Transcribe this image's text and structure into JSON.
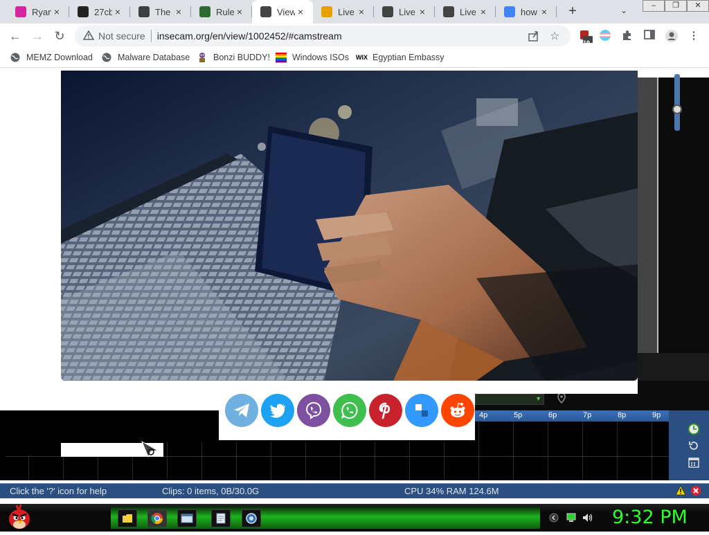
{
  "tabs": [
    {
      "title": "Ryan",
      "icon": "instagram-icon",
      "color": "#d6249f",
      "active": false
    },
    {
      "title": "27cb",
      "icon": "b-site-icon",
      "color": "#222222",
      "active": false
    },
    {
      "title": "The",
      "icon": "factory-icon",
      "color": "#3c4043",
      "active": false
    },
    {
      "title": "Rule",
      "icon": "rule-site-icon",
      "color": "#2e6b2e",
      "active": false
    },
    {
      "title": "View",
      "icon": "camera-icon",
      "color": "#444444",
      "active": true
    },
    {
      "title": "Live",
      "icon": "triangle-icon",
      "color": "#e8a000",
      "active": false
    },
    {
      "title": "Live",
      "icon": "camera-icon",
      "color": "#444444",
      "active": false
    },
    {
      "title": "Live",
      "icon": "camera-icon",
      "color": "#444444",
      "active": false
    },
    {
      "title": "how",
      "icon": "google-icon",
      "color": "#4285f4",
      "active": false
    }
  ],
  "tab_close_glyph": "×",
  "newtab_glyph": "+",
  "tabmenu_glyph": "⌄",
  "window_buttons": {
    "minimize": "–",
    "restore": "❐",
    "close": "✕"
  },
  "toolbar": {
    "back": "←",
    "forward": "→",
    "reload": "↻",
    "security_label": "Not secure",
    "url": "insecam.org/en/view/1002452/#camstream",
    "extension_badge": "19"
  },
  "bookmarks": [
    {
      "label": "MEMZ Download",
      "icon": "globe-icon"
    },
    {
      "label": "Malware Database",
      "icon": "globe-icon"
    },
    {
      "label": "Bonzi BUDDY!",
      "icon": "bonzi-icon"
    },
    {
      "label": "Windows ISOs",
      "icon": "windows-icon"
    },
    {
      "label": "Egyptian Embassy",
      "icon": "wix-icon"
    }
  ],
  "wix_text": "WIX",
  "share_buttons": [
    {
      "name": "telegram",
      "color": "#6fb0e0"
    },
    {
      "name": "twitter",
      "color": "#1da1f2"
    },
    {
      "name": "viber",
      "color": "#7d51a0"
    },
    {
      "name": "whatsapp",
      "color": "#3fbf4f"
    },
    {
      "name": "pinterest",
      "color": "#c8232c"
    },
    {
      "name": "delicious",
      "color": "#3399ff"
    },
    {
      "name": "reddit",
      "color": "#ff4500"
    }
  ],
  "timeline_hours": [
    "4p",
    "5p",
    "6p",
    "7p",
    "8p",
    "9p"
  ],
  "statusbar": {
    "help": "Click the '?' icon for help",
    "clips": "Clips: 0 items, 0B/30.0G",
    "system": "CPU 34% RAM 124.6M"
  },
  "taskbar": {
    "clock": "9:32 PM",
    "apps": [
      "folder-icon",
      "chrome-icon",
      "window-icon",
      "notepad-icon",
      "app-icon"
    ]
  }
}
